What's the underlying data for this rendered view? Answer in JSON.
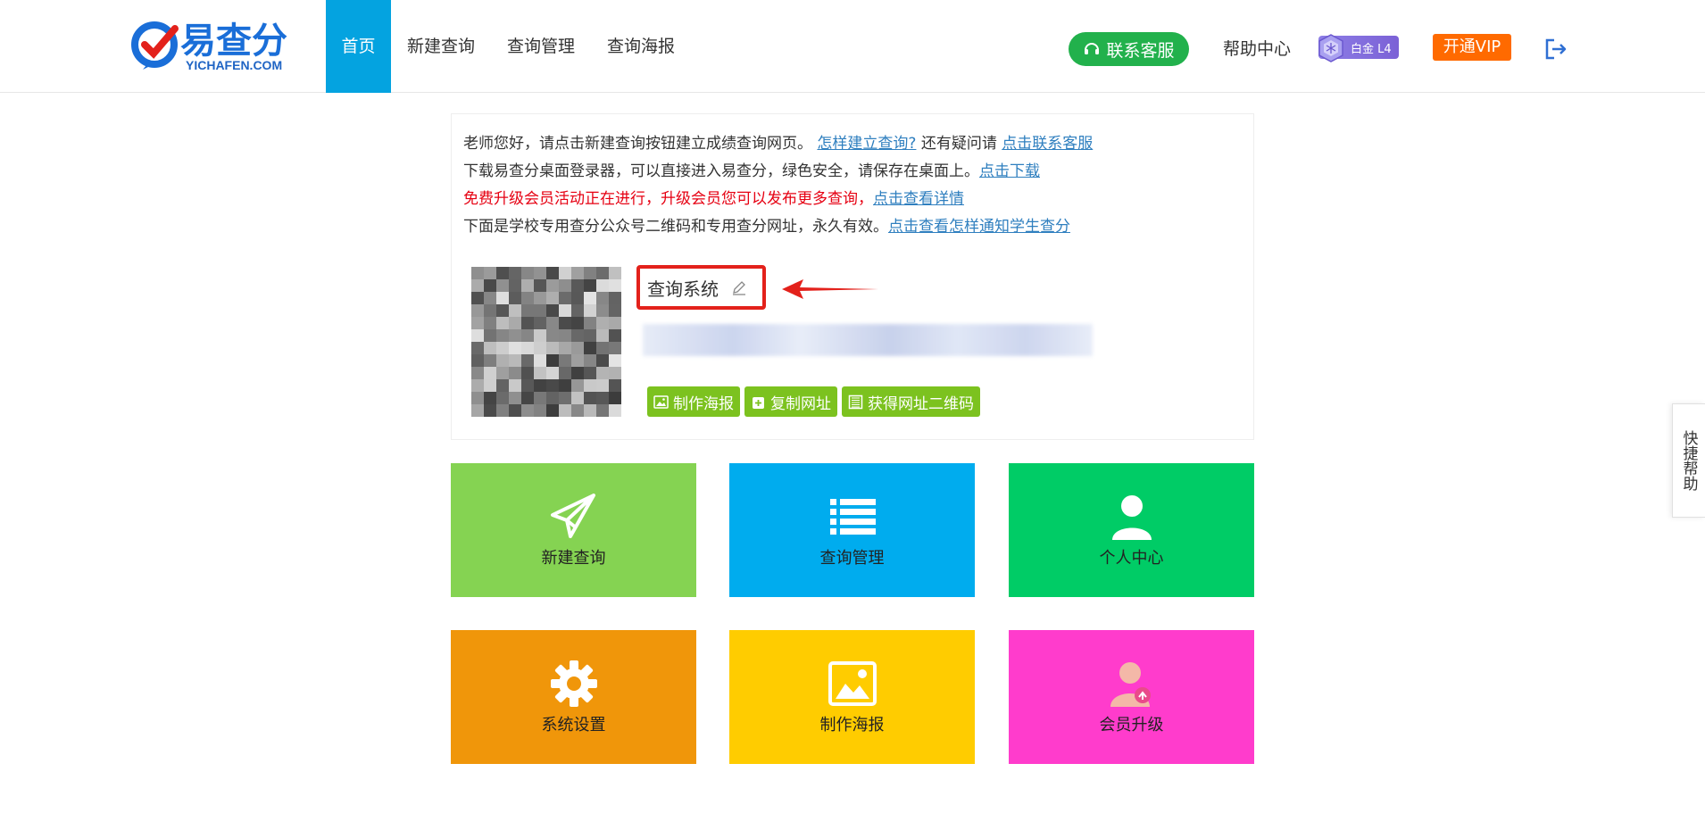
{
  "header": {
    "logo_name": "易查分",
    "logo_url": "YICHAFEN.COM",
    "nav": [
      "首页",
      "新建查询",
      "查询管理",
      "查询海报"
    ],
    "service_button": "联系客服",
    "help_center": "帮助中心",
    "member_badge": "白金 L4",
    "vip_button": "开通VIP"
  },
  "info": {
    "line1_text": "老师您好，请点击新建查询按钮建立成绩查询网页。",
    "line1_link1": "怎样建立查询?",
    "line1_mid": "还有疑问请",
    "line1_link2": "点击联系客服",
    "line2_text": "下载易查分桌面登录器，可以直接进入易查分，绿色安全，请保存在桌面上。",
    "line2_link": "点击下载",
    "line3_text": "免费升级会员活动正在进行，升级会员您可以发布更多查询，",
    "line3_link": "点击查看详情",
    "line4_text": "下面是学校专用查分公众号二维码和专用查分网址，永久有效。",
    "line4_link": "点击查看怎样通知学生查分"
  },
  "system": {
    "title": "查询系统",
    "buttons": [
      "制作海报",
      "复制网址",
      "获得网址二维码"
    ]
  },
  "tiles": [
    {
      "label": "新建查询",
      "color": "#85d352",
      "icon": "paper-plane-icon"
    },
    {
      "label": "查询管理",
      "color": "#00acee",
      "icon": "list-icon"
    },
    {
      "label": "个人中心",
      "color": "#00cc66",
      "icon": "user-icon"
    },
    {
      "label": "系统设置",
      "color": "#f0960a",
      "icon": "gear-icon"
    },
    {
      "label": "制作海报",
      "color": "#ffcc00",
      "icon": "image-icon"
    },
    {
      "label": "会员升级",
      "color": "#ff3ccc",
      "icon": "member-upgrade-icon"
    }
  ],
  "colors": {
    "nav_active": "#04a3e0",
    "service_green": "#22b14c",
    "vip_orange": "#ff6a00",
    "action_green": "#7cc21f",
    "highlight_red": "#e3211b"
  },
  "quick_help": "快捷帮助"
}
